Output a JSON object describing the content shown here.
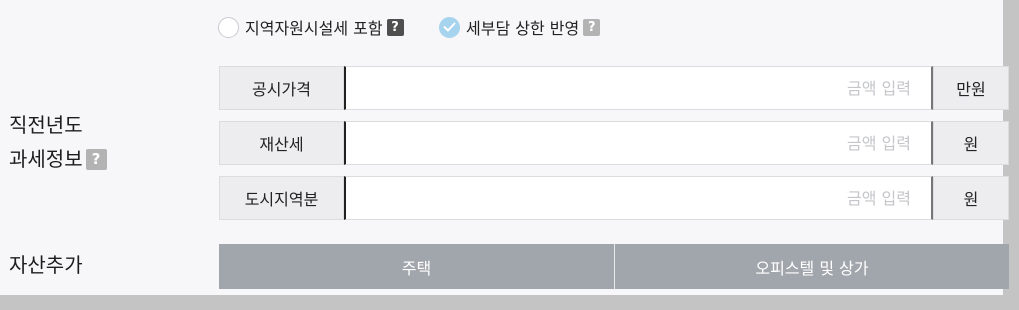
{
  "options": [
    {
      "label": "지역자원시설세 포함",
      "checked": false
    },
    {
      "label": "세부담 상한 반영",
      "checked": true
    }
  ],
  "help_icon": "?",
  "prior_year_section": {
    "line1": "직전년도",
    "line2": "과세정보"
  },
  "fields": [
    {
      "label": "공시가격",
      "placeholder": "금액 입력",
      "unit": "만원"
    },
    {
      "label": "재산세",
      "placeholder": "금액 입력",
      "unit": "원"
    },
    {
      "label": "도시지역분",
      "placeholder": "금액 입력",
      "unit": "원"
    }
  ],
  "add_asset": {
    "title": "자산추가",
    "tabs": [
      "주택",
      "오피스텔 및 상가"
    ]
  },
  "colors": {
    "check_accent": "#a6d3ee",
    "tab_bg": "#a1a6ac"
  }
}
